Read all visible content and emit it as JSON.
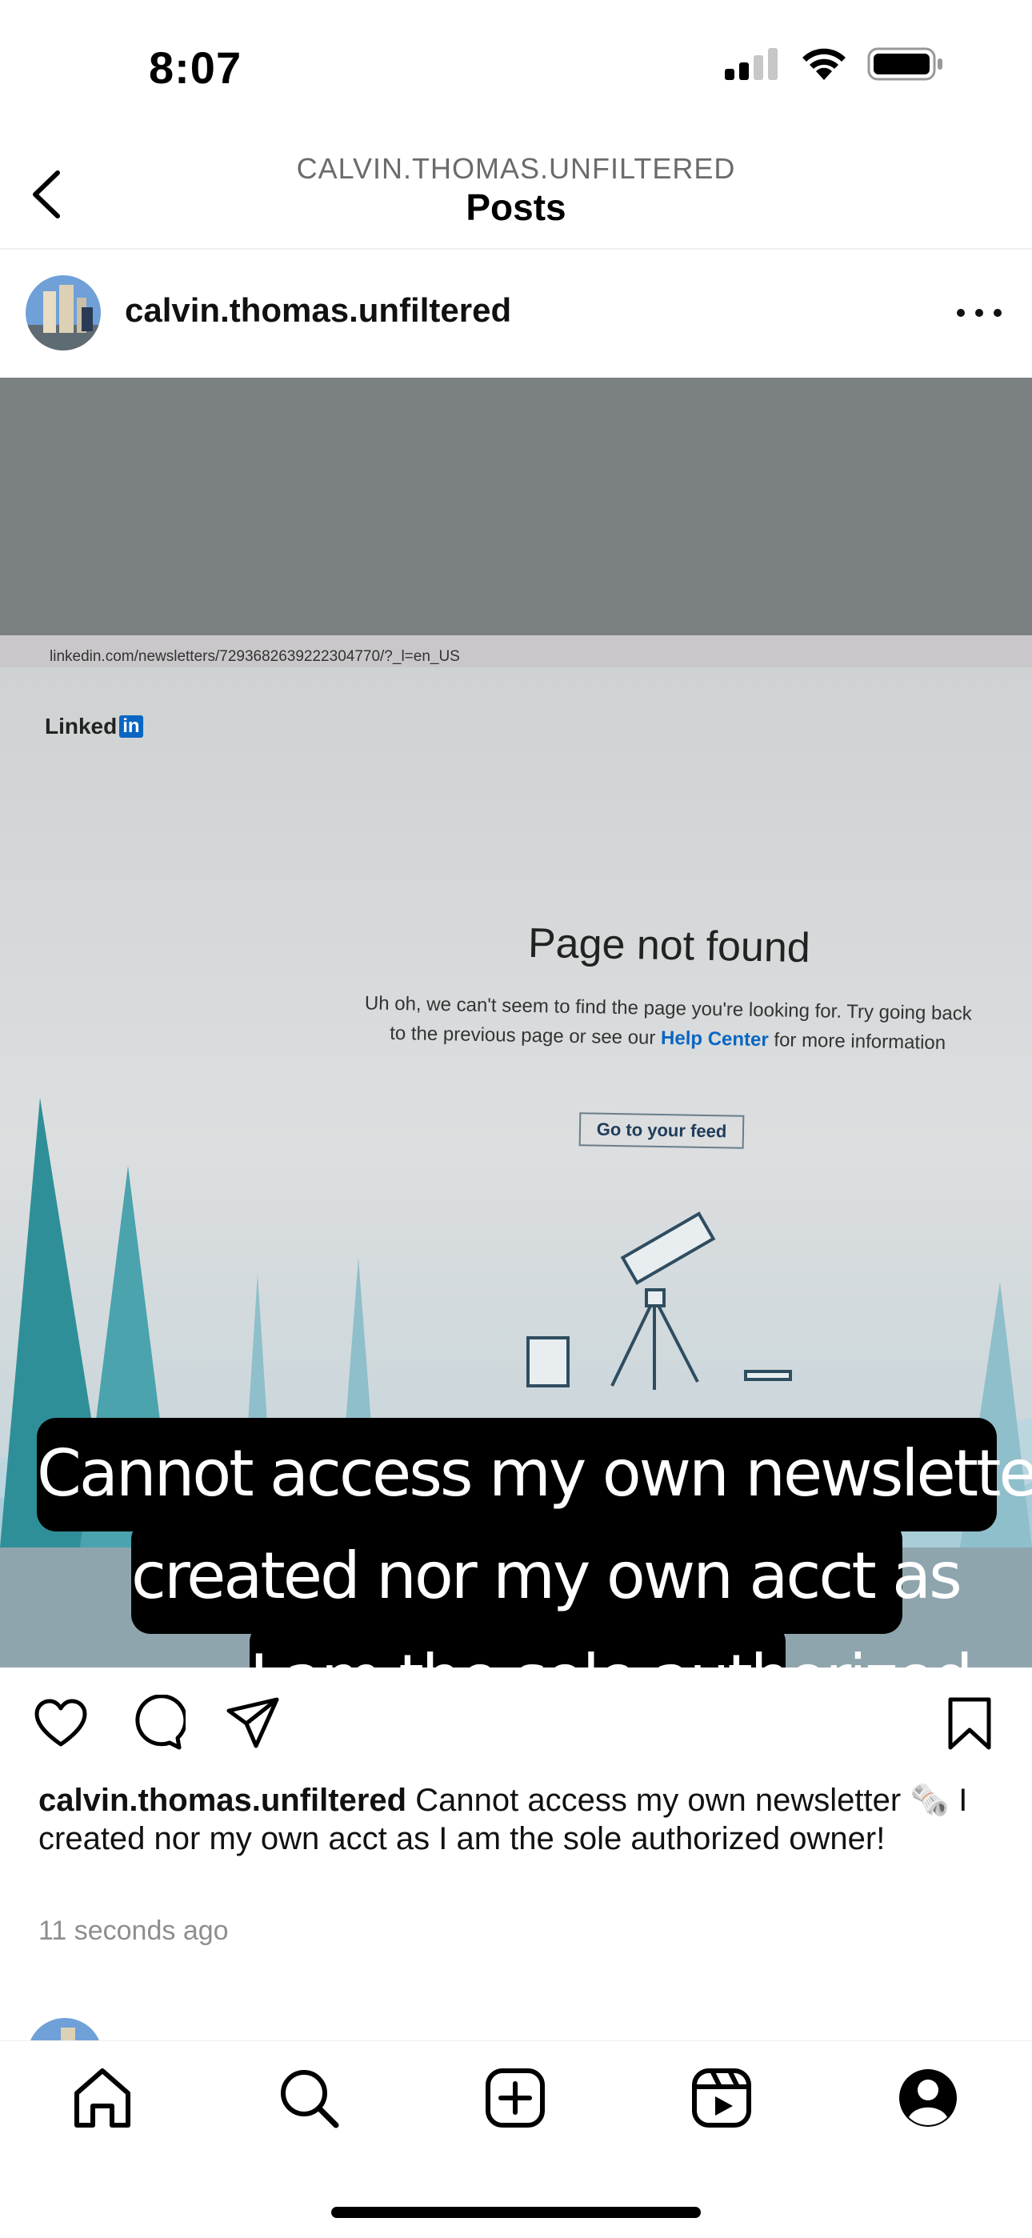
{
  "status_bar": {
    "time": "8:07"
  },
  "header": {
    "subtitle": "CALVIN.THOMAS.UNFILTERED",
    "title": "Posts"
  },
  "post": {
    "username": "calvin.thomas.unfiltered",
    "image": {
      "url_bar_text": "linkedin.com/newsletters/7293682639222304770/?_l=en_US",
      "logo_text": "Linked",
      "logo_badge": "in",
      "page_title": "Page not found",
      "body_prefix": "Uh oh, we can't seem to find the page you're looking for. Try going back to the previous page or see our ",
      "help_link": "Help Center",
      "body_suffix": " for more information",
      "button_label": "Go to your feed",
      "overlay_caption": {
        "line1": "Cannot access my own newsletter I",
        "line2": "created nor my own acct as",
        "line3": "I am the sole authorized"
      }
    },
    "caption": {
      "username": "calvin.thomas.unfiltered",
      "text": " Cannot access my own newsletter 🗞️ I created nor my own acct as I am the sole authorized owner!"
    },
    "timestamp": "11 seconds ago"
  },
  "icons": {
    "back": "chevron-left-icon",
    "more": "more-horizontal-icon",
    "like": "heart-icon",
    "comment": "comment-icon",
    "share": "paper-plane-icon",
    "save": "bookmark-icon",
    "tabs": [
      "home-icon",
      "search-icon",
      "create-icon",
      "reels-icon",
      "profile-icon"
    ]
  },
  "colors": {
    "linkedin_blue": "#0a66c2",
    "secondary_text": "#8e8e8e"
  }
}
